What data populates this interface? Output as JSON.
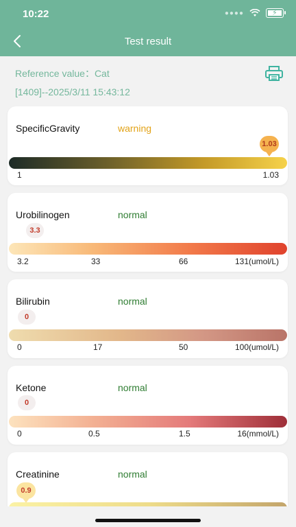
{
  "status_bar": {
    "time": "10:22"
  },
  "header": {
    "title": "Test result",
    "back_icon": "chevron-left-icon",
    "color": "#6fb59a"
  },
  "info": {
    "reference": "Reference value：Cat",
    "record": "[1409]--2025/3/11 15:43:12",
    "print_icon": "printer-icon"
  },
  "items": [
    {
      "name": "SpecificGravity",
      "status": "warning",
      "value": "1.03",
      "ticks": [
        "1",
        "1.03"
      ]
    },
    {
      "name": "Urobilinogen",
      "status": "normal",
      "value": "3.3",
      "ticks": [
        "3.2",
        "33",
        "66",
        "131(umol/L)"
      ]
    },
    {
      "name": "Bilirubin",
      "status": "normal",
      "value": "0",
      "ticks": [
        "0",
        "17",
        "50",
        "100(umol/L)"
      ]
    },
    {
      "name": "Ketone",
      "status": "normal",
      "value": "0",
      "ticks": [
        "0",
        "0.5",
        "1.5",
        "16(mmol/L)"
      ]
    },
    {
      "name": "Creatinine",
      "status": "normal",
      "value": "0.9",
      "ticks": []
    }
  ],
  "colors": {
    "normal": "#2f7d32",
    "warning": "#e2a216",
    "accent": "#74b79c"
  }
}
